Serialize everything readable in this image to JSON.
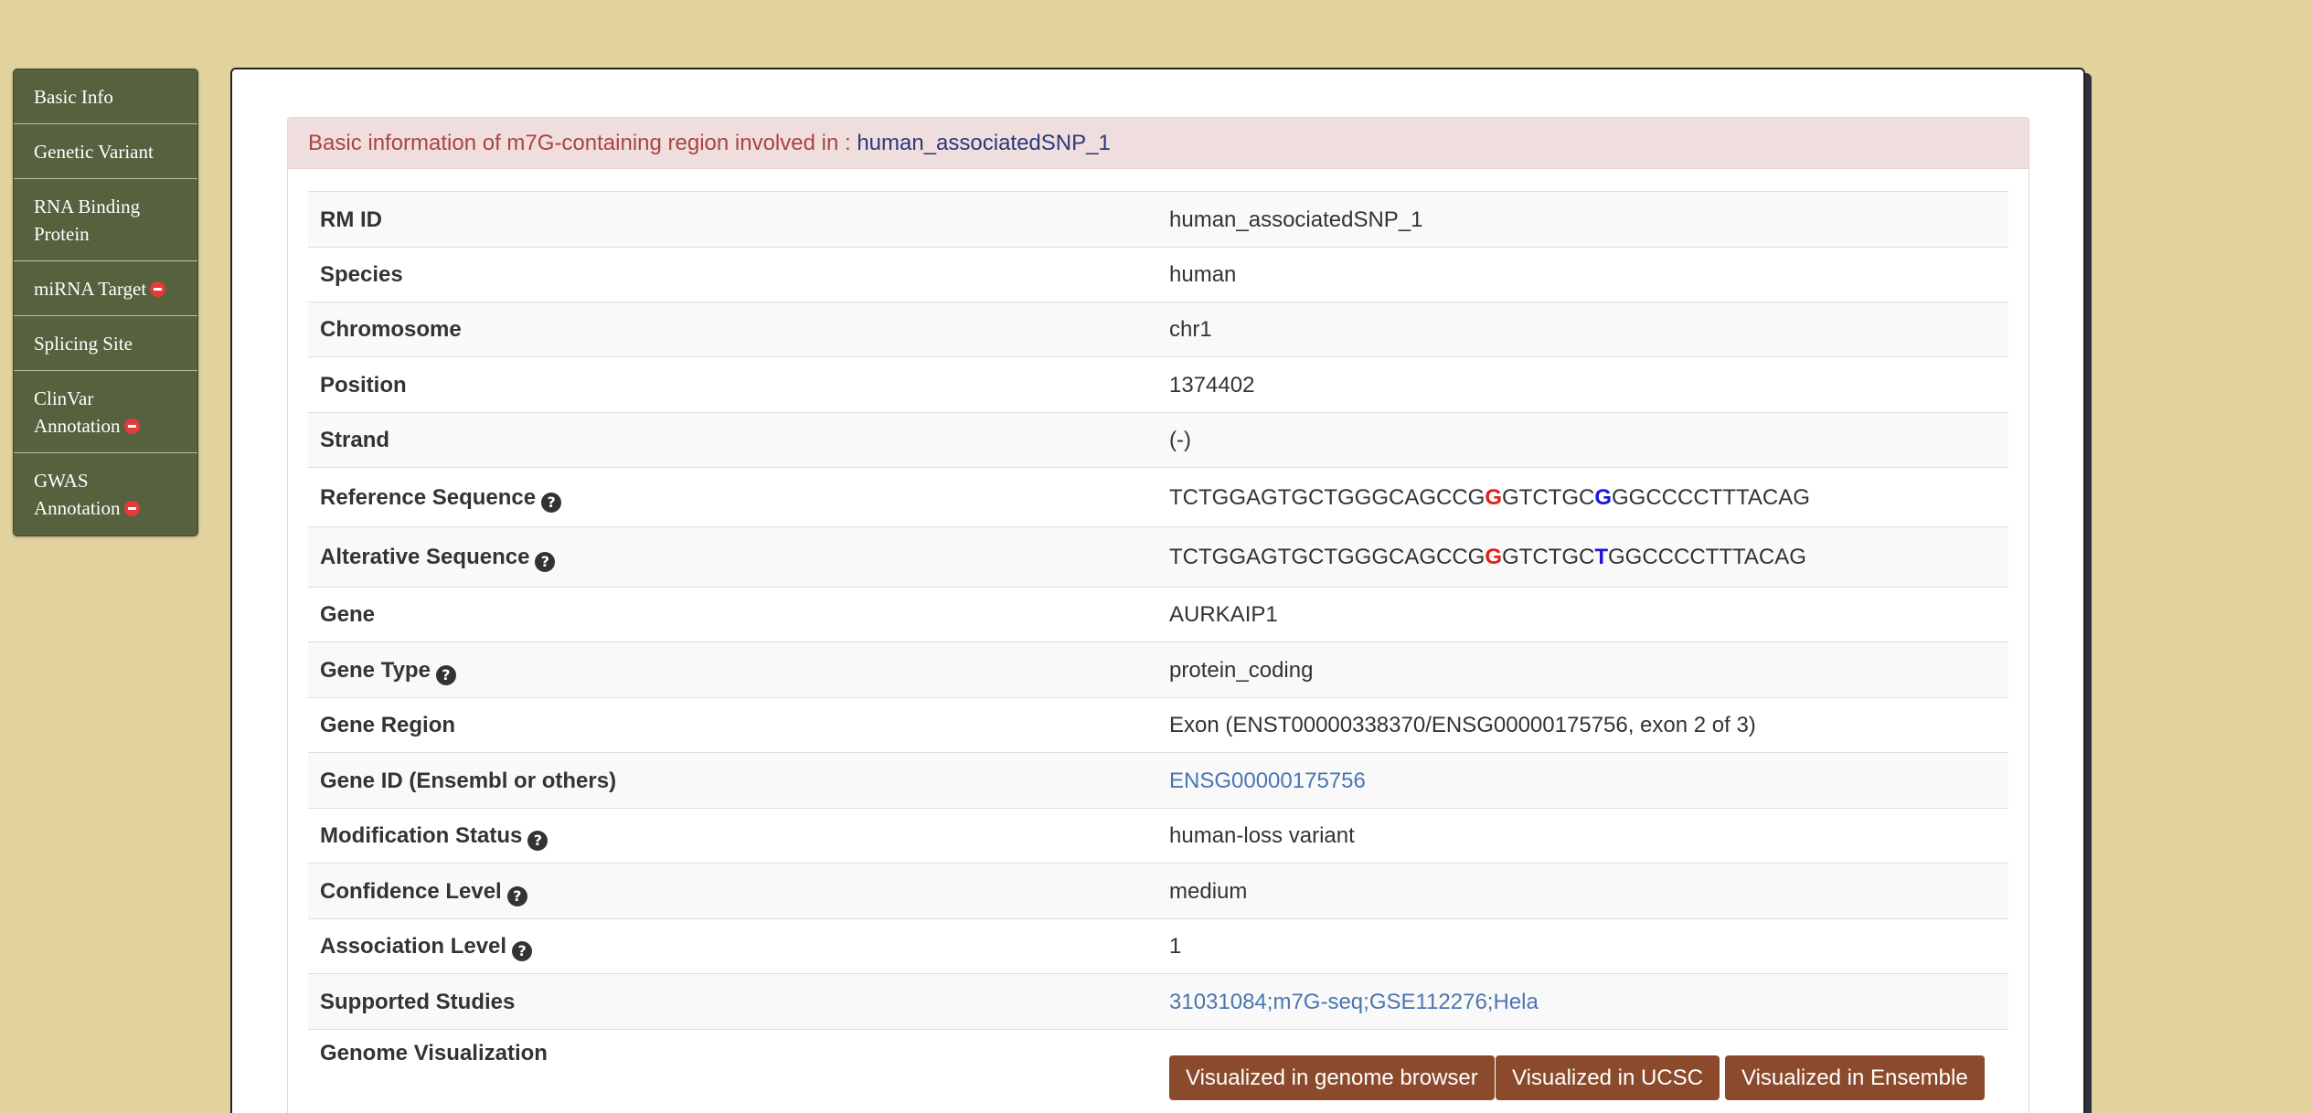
{
  "sidebar": {
    "items": [
      {
        "label": "Basic Info"
      },
      {
        "label": "Genetic Variant"
      },
      {
        "label": "RNA Binding Protein"
      },
      {
        "label": "miRNA Target"
      },
      {
        "label": "Splicing Site"
      },
      {
        "label": "ClinVar Annotation"
      },
      {
        "label": "GWAS Annotation"
      }
    ]
  },
  "heading": {
    "prefix": "Basic information of m7G-containing region involved in : ",
    "rm_id": "human_associatedSNP_1"
  },
  "table": {
    "rm_id": {
      "label": "RM ID",
      "value": "human_associatedSNP_1"
    },
    "species": {
      "label": "Species",
      "value": "human"
    },
    "chromosome": {
      "label": "Chromosome",
      "value": "chr1"
    },
    "position": {
      "label": "Position",
      "value": "1374402"
    },
    "strand": {
      "label": "Strand",
      "value": "(-)"
    },
    "reference_sequence": {
      "label": "Reference Sequence",
      "seq_a": "TCTGGAGTGCTGGGCAGCCG",
      "mod_base": "G",
      "seq_b": "GTCTGC",
      "variant_base": "G",
      "seq_c": "GGCCCCTTTACAG"
    },
    "alterative_sequence": {
      "label": "Alterative Sequence",
      "seq_a": "TCTGGAGTGCTGGGCAGCCG",
      "mod_base": "G",
      "seq_b": "GTCTGC",
      "variant_base": "T",
      "seq_c": "GGCCCCTTTACAG"
    },
    "gene": {
      "label": "Gene",
      "value": "AURKAIP1"
    },
    "gene_type": {
      "label": "Gene Type",
      "value": "protein_coding"
    },
    "gene_region": {
      "label": "Gene Region",
      "value": "Exon (ENST00000338370/ENSG00000175756, exon 2 of 3)"
    },
    "gene_id": {
      "label": "Gene ID (Ensembl or others)",
      "value": "ENSG00000175756"
    },
    "modification_status": {
      "label": "Modification Status",
      "value": "human-loss variant"
    },
    "confidence_level": {
      "label": "Confidence Level",
      "value": "medium"
    },
    "association_level": {
      "label": "Association Level",
      "value": "1"
    },
    "supported_studies": {
      "label": "Supported Studies",
      "value": "31031084;m7G-seq;GSE112276;Hela"
    },
    "genome_visualization": {
      "label": "Genome Visualization",
      "buttons": [
        "Visualized in genome browser",
        "Visualized in UCSC",
        "Visualized in Ensemble"
      ]
    }
  },
  "icons": {
    "help": "question-circle-icon",
    "remove": "minus-circle-icon"
  },
  "colors": {
    "page_background": "#e2d29e",
    "sidebar_background": "#56613e",
    "heading_background": "#f0dede",
    "heading_text": "#a94442",
    "link": "#4a76b0",
    "button": "#8b4a2c",
    "modification_base": "#e0201e",
    "variant_base": "#1a17d8"
  }
}
